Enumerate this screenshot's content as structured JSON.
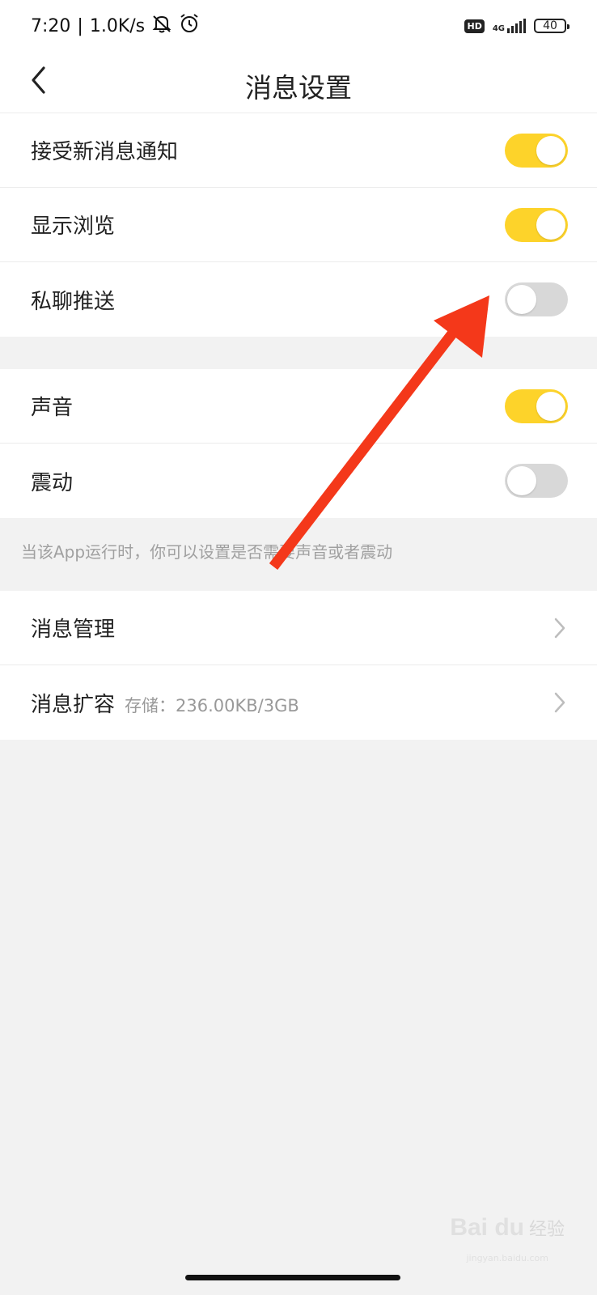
{
  "status_bar": {
    "time": "7:20",
    "separator": "|",
    "net_speed": "1.0K/s",
    "icons": [
      "bell-off-icon",
      "alarm-icon"
    ],
    "hd_label": "HD",
    "network_type": "4G",
    "battery_level": "40"
  },
  "header": {
    "title": "消息设置",
    "back_icon": "chevron-left-icon"
  },
  "group1": [
    {
      "label": "接受新消息通知",
      "enabled": true
    },
    {
      "label": "显示浏览",
      "enabled": true
    },
    {
      "label": "私聊推送",
      "enabled": false
    }
  ],
  "group2": [
    {
      "label": "声音",
      "enabled": true
    },
    {
      "label": "震动",
      "enabled": false
    }
  ],
  "hint_text": "当该App运行时，你可以设置是否需要声音或者震动",
  "group3": [
    {
      "label": "消息管理",
      "sub": ""
    },
    {
      "label": "消息扩容",
      "sub": "存储：236.00KB/3GB"
    }
  ],
  "colors": {
    "accent": "#fdd32a",
    "toggle_off": "#d8d8d8",
    "annotation_arrow": "#f4381a",
    "background": "#f2f2f2"
  },
  "watermark": {
    "logo": "Bai du",
    "text": "经验",
    "url": "jingyan.baidu.com"
  }
}
